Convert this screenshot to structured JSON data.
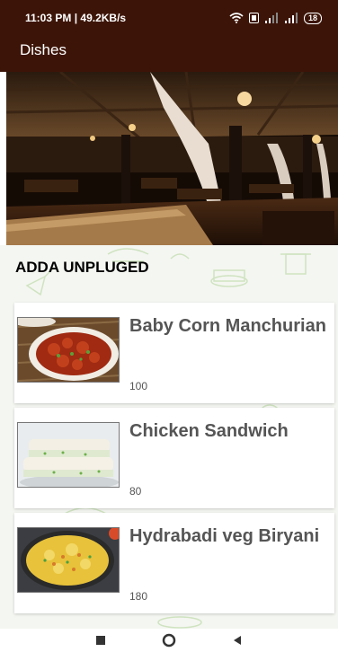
{
  "status_bar": {
    "time_speed": "11:03 PM | 49.2KB/s",
    "battery": "18",
    "icons": [
      "wifi-icon",
      "sim-icon",
      "signal-icon",
      "signal-icon",
      "battery-icon"
    ]
  },
  "app_bar": {
    "title": "Dishes"
  },
  "restaurant": {
    "name": "ADDA UNPLUGED"
  },
  "dishes": [
    {
      "name": "Baby Corn Manchurian",
      "price": "100"
    },
    {
      "name": "Chicken Sandwich",
      "price": "80"
    },
    {
      "name": "Hydrabadi veg Biryani",
      "price": "180"
    }
  ],
  "nav": {
    "icons": [
      "recents-square-icon",
      "home-circle-icon",
      "back-triangle-icon"
    ]
  }
}
